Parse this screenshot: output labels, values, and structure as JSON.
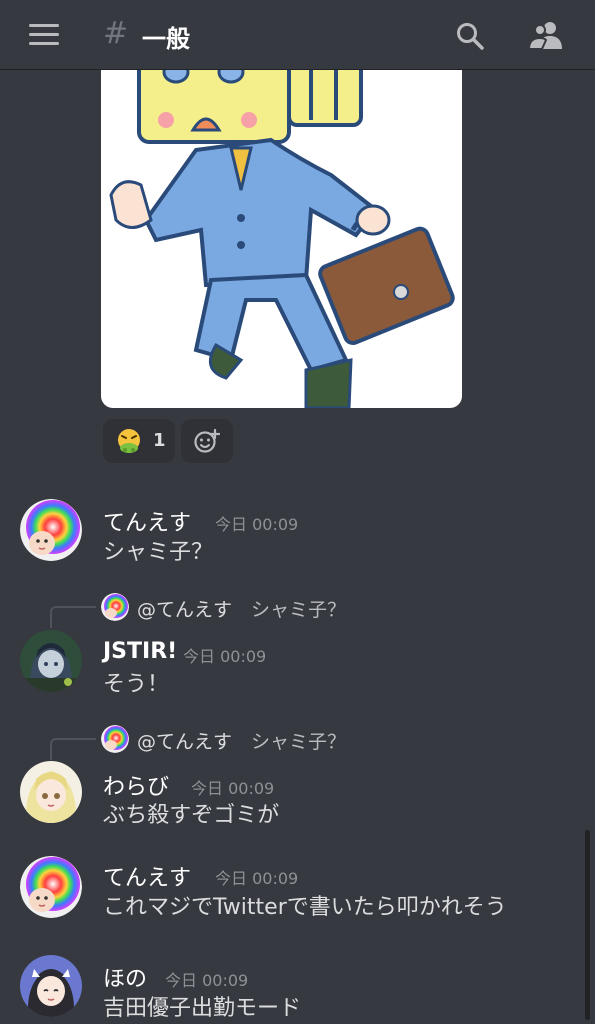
{
  "header": {
    "hash": "#",
    "channel_name": "一般"
  },
  "reactions": {
    "emoji_count": "1"
  },
  "messages": [
    {
      "user": "てんえす",
      "time": "今日 00:09",
      "text": "シャミ子？"
    },
    {
      "reply_user": "@てんえす",
      "reply_text": "シャミ子？",
      "user": "JSTIR!",
      "time": "今日 00:09",
      "text": "そう！"
    },
    {
      "reply_user": "@てんえす",
      "reply_text": "シャミ子？",
      "user": "わらび",
      "time": "今日 00:09",
      "text": "ぶち殺すぞゴミが"
    },
    {
      "user": "てんえす",
      "time": "今日 00:09",
      "text": "これマジでTwitterで書いたら叩かれそう"
    },
    {
      "user": "ほの",
      "time": "今日 00:09",
      "text": "吉田優子出勤モード"
    }
  ],
  "colors": {
    "background": "#36393f",
    "reaction_bg": "#2f3136",
    "timestamp": "#8e9297"
  }
}
